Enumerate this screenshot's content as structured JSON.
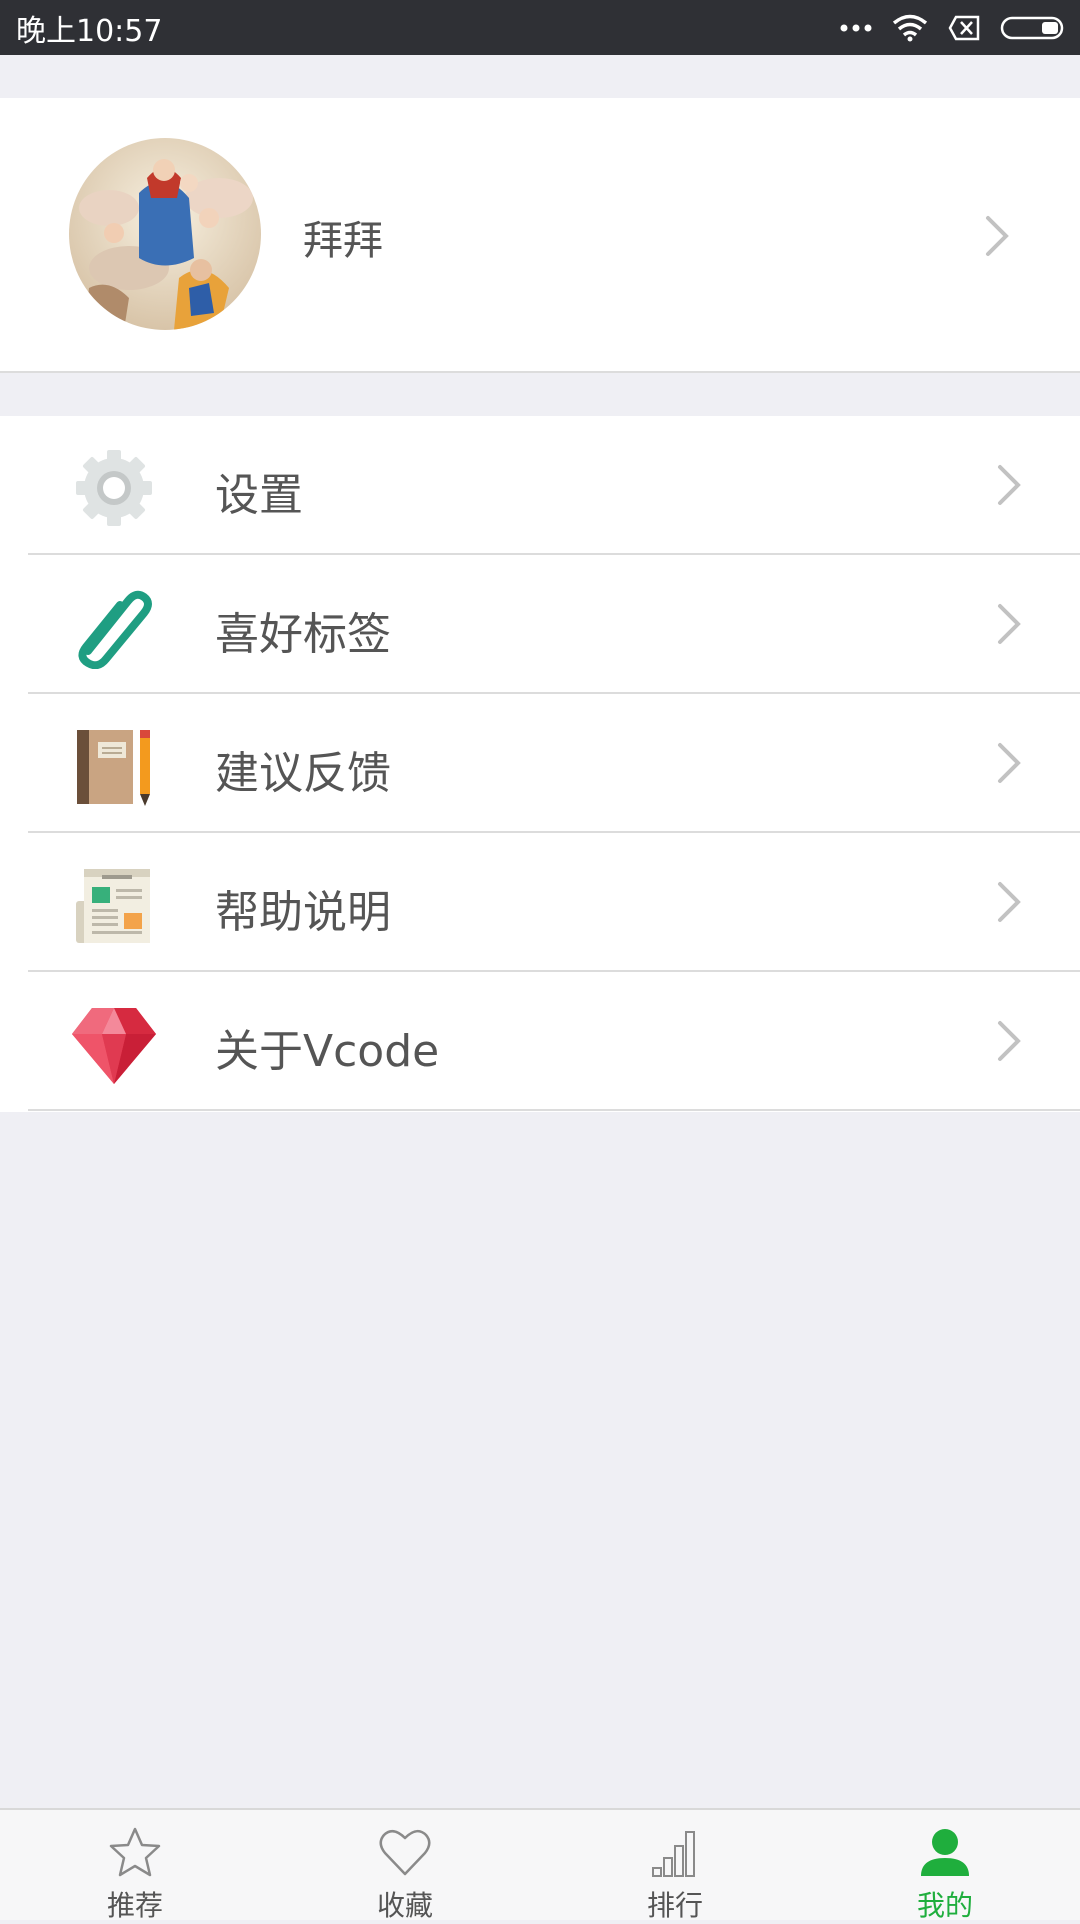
{
  "status_bar": {
    "time": "晚上10:57"
  },
  "profile": {
    "username": "拜拜"
  },
  "menu": {
    "items": [
      {
        "label": "设置",
        "icon": "gear-icon"
      },
      {
        "label": "喜好标签",
        "icon": "paperclip-icon"
      },
      {
        "label": "建议反馈",
        "icon": "notebook-pencil-icon"
      },
      {
        "label": "帮助说明",
        "icon": "newspaper-icon"
      },
      {
        "label": "关于Vcode",
        "icon": "gem-icon"
      }
    ]
  },
  "tabbar": {
    "active": "我的",
    "active_color": "#1fae3d",
    "tabs": [
      {
        "label": "推荐",
        "icon": "star-icon"
      },
      {
        "label": "收藏",
        "icon": "heart-icon"
      },
      {
        "label": "排行",
        "icon": "bar-chart-icon"
      },
      {
        "label": "我的",
        "icon": "person-icon"
      }
    ]
  }
}
